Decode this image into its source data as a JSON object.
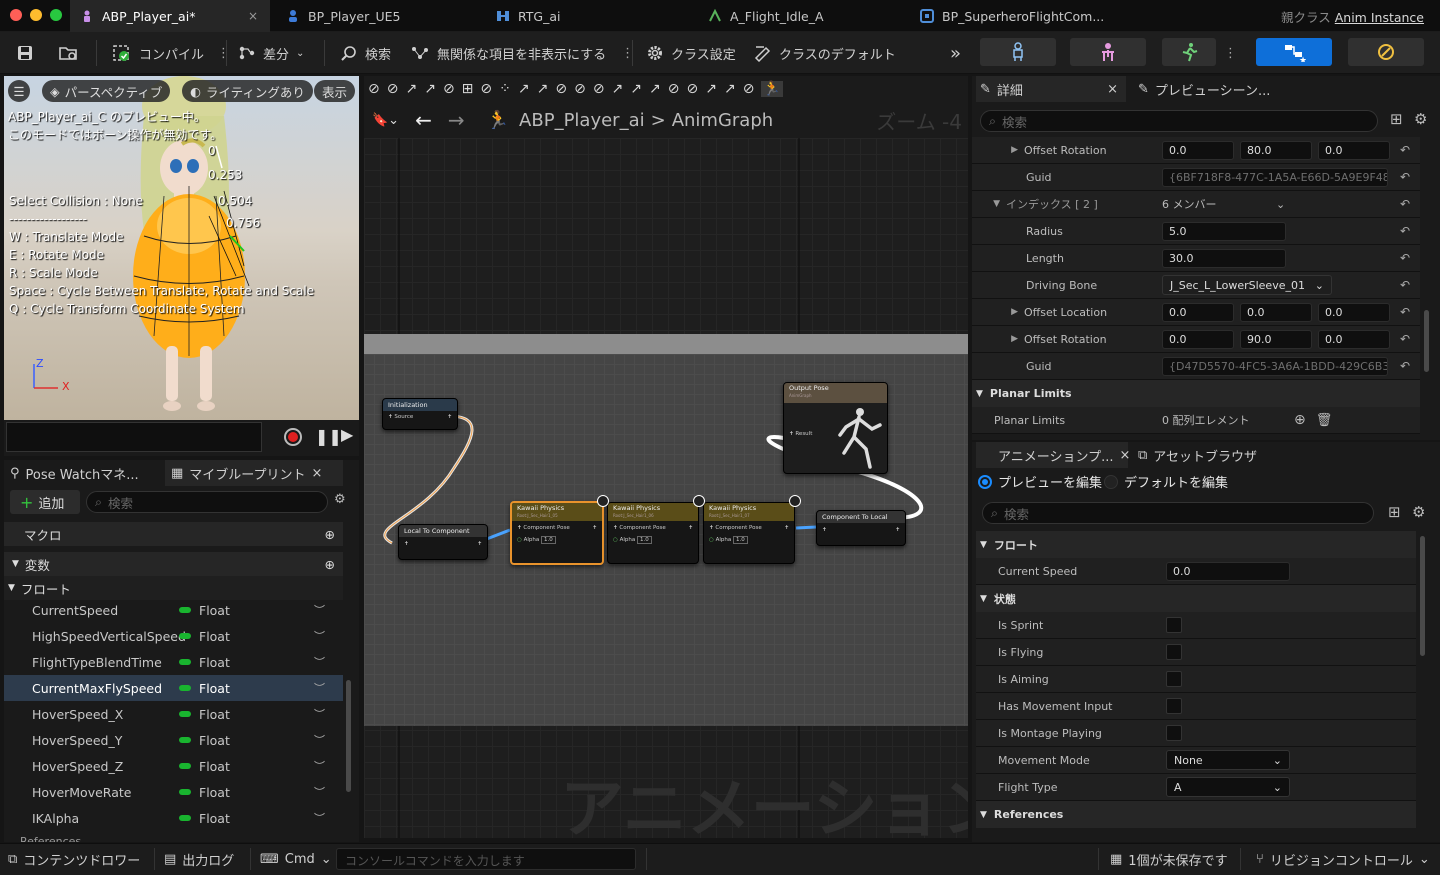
{
  "tabs": [
    {
      "label": "ABP_Player_ai*",
      "close": "×"
    },
    {
      "label": "BP_Player_UE5"
    },
    {
      "label": "RTG_ai"
    },
    {
      "label": "A_Flight_Idle_A"
    },
    {
      "label": "BP_SuperheroFlightCom..."
    }
  ],
  "parent_class": {
    "prefix": "親クラス",
    "name": "Anim Instance"
  },
  "toolbar": {
    "compile": "コンパイル",
    "diff": "差分",
    "find": "検索",
    "hide_unrelated": "無関係な項目を非表示にする",
    "class_settings": "クラス設定",
    "class_defaults": "クラスのデフォルト"
  },
  "viewport": {
    "perspective": "パースペクティブ",
    "lighting": "ライティングあり",
    "show": "表示",
    "preview_line1": "ABP_Player_ai_C のプレビュー中。",
    "preview_line2": "このモードではボーン操作が無効です。",
    "readouts": [
      "0",
      "0.253",
      "0.504",
      "0.756"
    ],
    "help_lines": [
      "Select Collision : None",
      "------------------",
      "W : Translate Mode",
      "E : Rotate Mode",
      "R : Scale Mode",
      "Space : Cycle Between Translate, Rotate and Scale",
      "Q : Cycle Transform Coordinate System"
    ],
    "axis_z": "Z",
    "axis_x": "X"
  },
  "pose_watch_tab": "Pose Watchマネ...",
  "my_blueprint": {
    "tab": "マイブループリント",
    "close": "×",
    "add": "追加",
    "search_placeholder": "検索",
    "cat_macro": "マクロ",
    "cat_vars": "変数",
    "cat_float": "フロート",
    "variables": [
      {
        "name": "CurrentSpeed",
        "type": "Float"
      },
      {
        "name": "HighSpeedVerticalSpeed",
        "type": "Float"
      },
      {
        "name": "FlightTypeBlendTime",
        "type": "Float"
      },
      {
        "name": "CurrentMaxFlySpeed",
        "type": "Float",
        "selected": true
      },
      {
        "name": "HoverSpeed_X",
        "type": "Float"
      },
      {
        "name": "HoverSpeed_Y",
        "type": "Float"
      },
      {
        "name": "HoverSpeed_Z",
        "type": "Float"
      },
      {
        "name": "HoverMoveRate",
        "type": "Float"
      },
      {
        "name": "IKAlpha",
        "type": "Float"
      }
    ],
    "cut_category": "References"
  },
  "graph": {
    "bp_name": "ABP_Player_ai",
    "sep": ">",
    "graph_name": "AnimGraph",
    "zoom": "ズーム -4",
    "watermark": "アニメーション",
    "nodes": {
      "init": {
        "title": "Initialization",
        "pin": "Source"
      },
      "l2c": {
        "title": "Local To Component"
      },
      "kp1": {
        "title": "Kawaii Physics",
        "sub": "Root:J_Sec_Hair1_05",
        "pin": "Component Pose",
        "alpha": "Alpha",
        "alpha_val": "1.0"
      },
      "kp2": {
        "title": "Kawaii Physics",
        "sub": "Root:J_Sec_Hair1_06",
        "pin": "Component Pose",
        "alpha": "Alpha",
        "alpha_val": "1.0"
      },
      "kp3": {
        "title": "Kawaii Physics",
        "sub": "Root:J_Sec_Hair1_07",
        "pin": "Component Pose",
        "alpha": "Alpha",
        "alpha_val": "1.0"
      },
      "c2l": {
        "title": "Component To Local"
      },
      "out": {
        "title": "Output Pose",
        "sub": "AnimGraph",
        "pin": "Result"
      }
    }
  },
  "details": {
    "tab": "詳細",
    "close": "×",
    "tab2": "プレビューシーン...",
    "search_placeholder": "検索",
    "rows": {
      "offset_rotation": "Offset Rotation",
      "rot1": [
        "0.0",
        "80.0",
        "0.0"
      ],
      "guid": "Guid",
      "guid1": "{6BF718F8-477C-1A5A-E66D-5A9E9F488...",
      "index": "インデックス [ 2 ]",
      "members": "6 メンバー",
      "radius": "Radius",
      "radius_val": "5.0",
      "length": "Length",
      "length_val": "30.0",
      "driving_bone": "Driving Bone",
      "driving_bone_val": "J_Sec_L_LowerSleeve_01",
      "offset_location": "Offset Location",
      "loc2": [
        "0.0",
        "0.0",
        "0.0"
      ],
      "rot2": [
        "0.0",
        "90.0",
        "0.0"
      ],
      "guid2": "{D47D5570-4FC5-3A6A-1BDD-429C6B3D1...",
      "planar_limits_hdr": "Planar Limits",
      "planar_limits": "Planar Limits",
      "planar_val": "0 配列エレメント"
    }
  },
  "anim_preview": {
    "tab": "アニメーションプ...",
    "close": "×",
    "tab2": "アセットブラウザ",
    "edit_preview": "プレビューを編集",
    "edit_defaults": "デフォルトを編集",
    "search_placeholder": "検索",
    "cat_float": "フロート",
    "current_speed": "Current Speed",
    "current_speed_val": "0.0",
    "cat_state": "状態",
    "bools": [
      "Is Sprint",
      "Is Flying",
      "Is Aiming",
      "Has Movement Input",
      "Is Montage Playing"
    ],
    "movement_mode": "Movement Mode",
    "movement_mode_val": "None",
    "flight_type": "Flight Type",
    "flight_type_val": "A",
    "references": "References"
  },
  "status": {
    "content_drawer": "コンテンツドロワー",
    "output_log": "出力ログ",
    "cmd": "Cmd",
    "console_placeholder": "コンソールコマンドを入力します",
    "unsaved": "1個が未保存です",
    "revision": "リビジョンコントロール"
  },
  "colors": {
    "accent": "#0e6fd9",
    "float_pin": "#19b42f",
    "selected_node": "#e9932c"
  }
}
